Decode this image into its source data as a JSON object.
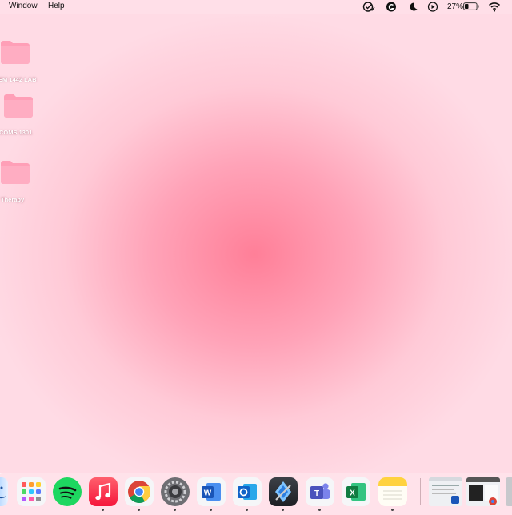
{
  "menubar": {
    "menus": [
      "Window",
      "Help"
    ],
    "battery_percent": "27%"
  },
  "desktop": {
    "folders": [
      {
        "label": "EM 1442 LAB",
        "icon": "folder-icon"
      },
      {
        "label": "COMS 1301",
        "icon": "folder-icon"
      },
      {
        "label": "Therapy",
        "icon": "folder-icon"
      }
    ],
    "folder_color": "#ff9fb7"
  },
  "dock": {
    "apps": [
      "finder",
      "launchpad",
      "spotify",
      "music",
      "chrome",
      "system-settings",
      "word",
      "outlook",
      "xcode",
      "teams",
      "excel",
      "notes"
    ],
    "recent_windows": [
      "word-window",
      "chrome-window"
    ],
    "trash": "trash"
  },
  "colors": {
    "background_center": "#ff7f98",
    "background_edge": "#ffdbe5"
  }
}
